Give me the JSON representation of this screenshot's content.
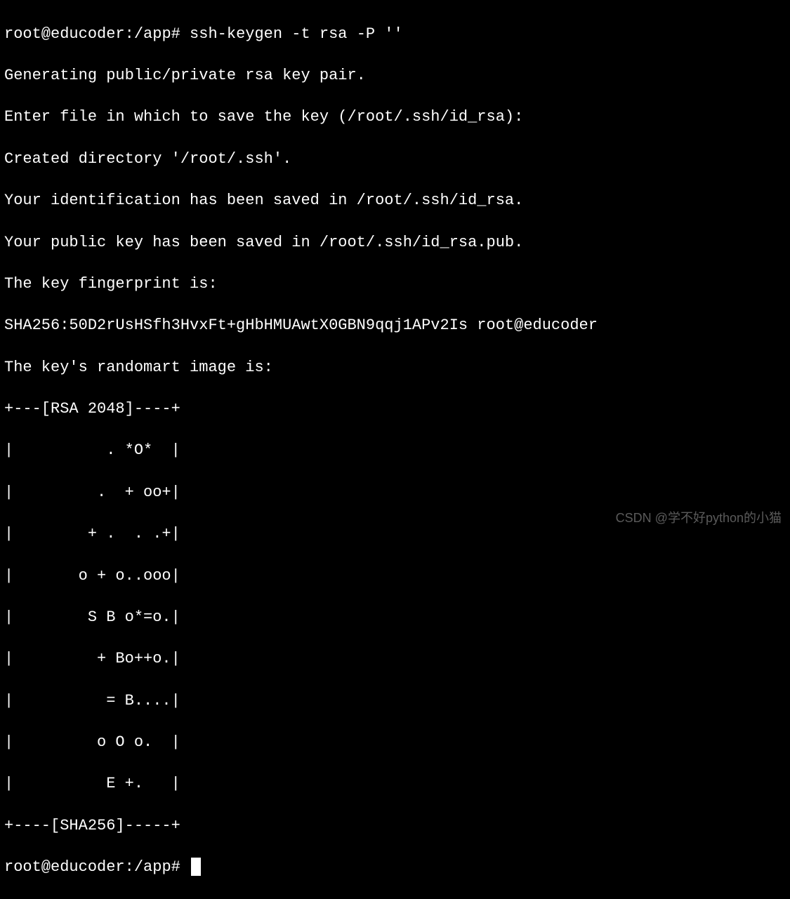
{
  "terminal": {
    "prompt1_user": "root@educoder",
    "prompt1_path": ":/app#",
    "command1": " ssh-keygen -t rsa -P ''",
    "output": [
      "Generating public/private rsa key pair.",
      "Enter file in which to save the key (/root/.ssh/id_rsa):",
      "Created directory '/root/.ssh'.",
      "Your identification has been saved in /root/.ssh/id_rsa.",
      "Your public key has been saved in /root/.ssh/id_rsa.pub.",
      "The key fingerprint is:",
      "SHA256:50D2rUsHSfh3HvxFt+gHbHMUAwtX0GBN9qqj1APv2Is root@educoder",
      "The key's randomart image is:",
      "+---[RSA 2048]----+",
      "|          . *O*  |",
      "|         .  + oo+|",
      "|        + .  . .+|",
      "|       o + o..ooo|",
      "|        S B o*=o.|",
      "|         + Bo++o.|",
      "|          = B....|",
      "|         o O o.  |",
      "|          E +.   |",
      "+----[SHA256]-----+"
    ],
    "prompt2_user": "root@educoder",
    "prompt2_path": ":/app#",
    "command2": " "
  },
  "watermark": "CSDN @学不好python的小猫"
}
